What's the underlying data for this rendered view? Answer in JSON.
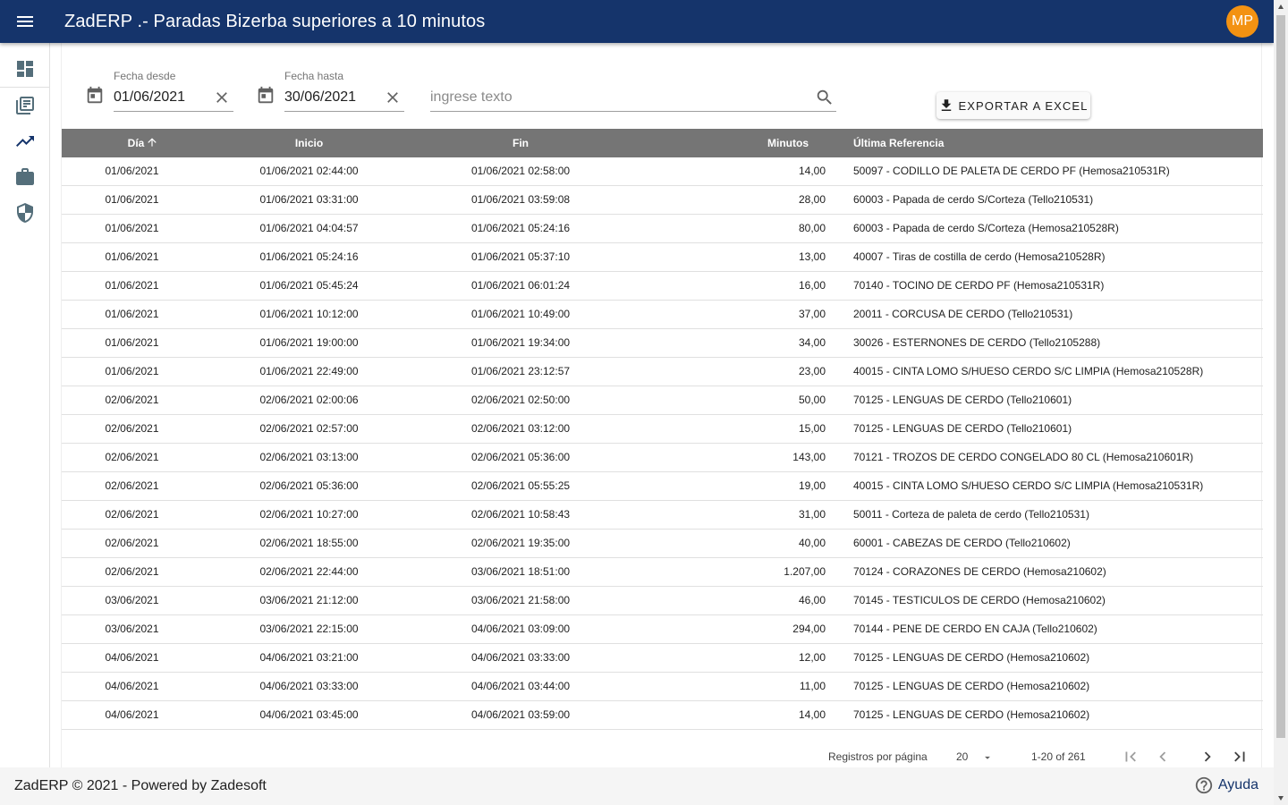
{
  "app": {
    "title": "ZadERP .- Paradas Bizerba superiores a 10 minutos",
    "user_initials": "MP",
    "accent_color": "#15346b",
    "avatar_color": "#f39212"
  },
  "sidebar": {
    "items": [
      {
        "icon": "dashboard-icon"
      },
      {
        "icon": "library-books-icon"
      },
      {
        "icon": "trending-up-icon"
      },
      {
        "icon": "briefcase-icon"
      },
      {
        "icon": "security-shield-icon"
      }
    ]
  },
  "filters": {
    "fecha_desde": {
      "label": "Fecha desde",
      "value": "01/06/2021"
    },
    "fecha_hasta": {
      "label": "Fecha hasta",
      "value": "30/06/2021"
    },
    "search": {
      "placeholder": "ingrese texto"
    },
    "export_label": "EXPORTAR A EXCEL"
  },
  "table": {
    "headers": {
      "dia": "Día",
      "inicio": "Inicio",
      "fin": "Fin",
      "minutos": "Minutos",
      "referencia": "Última Referencia"
    },
    "rows": [
      {
        "dia": "01/06/2021",
        "inicio": "01/06/2021 02:44:00",
        "fin": "01/06/2021 02:58:00",
        "minutos": "14,00",
        "referencia": "50097 - CODILLO DE PALETA DE CERDO PF (Hemosa210531R)"
      },
      {
        "dia": "01/06/2021",
        "inicio": "01/06/2021 03:31:00",
        "fin": "01/06/2021 03:59:08",
        "minutos": "28,00",
        "referencia": "60003 - Papada de cerdo S/Corteza (Tello210531)"
      },
      {
        "dia": "01/06/2021",
        "inicio": "01/06/2021 04:04:57",
        "fin": "01/06/2021 05:24:16",
        "minutos": "80,00",
        "referencia": "60003 - Papada de cerdo S/Corteza (Hemosa210528R)"
      },
      {
        "dia": "01/06/2021",
        "inicio": "01/06/2021 05:24:16",
        "fin": "01/06/2021 05:37:10",
        "minutos": "13,00",
        "referencia": "40007 - Tiras de costilla de cerdo (Hemosa210528R)"
      },
      {
        "dia": "01/06/2021",
        "inicio": "01/06/2021 05:45:24",
        "fin": "01/06/2021 06:01:24",
        "minutos": "16,00",
        "referencia": "70140 - TOCINO DE CERDO PF (Hemosa210531R)"
      },
      {
        "dia": "01/06/2021",
        "inicio": "01/06/2021 10:12:00",
        "fin": "01/06/2021 10:49:00",
        "minutos": "37,00",
        "referencia": "20011 - CORCUSA DE CERDO (Tello210531)"
      },
      {
        "dia": "01/06/2021",
        "inicio": "01/06/2021 19:00:00",
        "fin": "01/06/2021 19:34:00",
        "minutos": "34,00",
        "referencia": "30026 - ESTERNONES DE CERDO (Tello2105288)"
      },
      {
        "dia": "01/06/2021",
        "inicio": "01/06/2021 22:49:00",
        "fin": "01/06/2021 23:12:57",
        "minutos": "23,00",
        "referencia": "40015 - CINTA LOMO S/HUESO CERDO S/C LIMPIA (Hemosa210528R)"
      },
      {
        "dia": "02/06/2021",
        "inicio": "02/06/2021 02:00:06",
        "fin": "02/06/2021 02:50:00",
        "minutos": "50,00",
        "referencia": "70125 - LENGUAS DE CERDO (Tello210601)"
      },
      {
        "dia": "02/06/2021",
        "inicio": "02/06/2021 02:57:00",
        "fin": "02/06/2021 03:12:00",
        "minutos": "15,00",
        "referencia": "70125 - LENGUAS DE CERDO (Tello210601)"
      },
      {
        "dia": "02/06/2021",
        "inicio": "02/06/2021 03:13:00",
        "fin": "02/06/2021 05:36:00",
        "minutos": "143,00",
        "referencia": "70121 - TROZOS DE CERDO CONGELADO 80 CL (Hemosa210601R)"
      },
      {
        "dia": "02/06/2021",
        "inicio": "02/06/2021 05:36:00",
        "fin": "02/06/2021 05:55:25",
        "minutos": "19,00",
        "referencia": "40015 - CINTA LOMO S/HUESO CERDO S/C LIMPIA (Hemosa210531R)"
      },
      {
        "dia": "02/06/2021",
        "inicio": "02/06/2021 10:27:00",
        "fin": "02/06/2021 10:58:43",
        "minutos": "31,00",
        "referencia": "50011 - Corteza de paleta de cerdo (Tello210531)"
      },
      {
        "dia": "02/06/2021",
        "inicio": "02/06/2021 18:55:00",
        "fin": "02/06/2021 19:35:00",
        "minutos": "40,00",
        "referencia": "60001 - CABEZAS DE CERDO (Tello210602)"
      },
      {
        "dia": "02/06/2021",
        "inicio": "02/06/2021 22:44:00",
        "fin": "03/06/2021 18:51:00",
        "minutos": "1.207,00",
        "referencia": "70124 - CORAZONES DE CERDO (Hemosa210602)"
      },
      {
        "dia": "03/06/2021",
        "inicio": "03/06/2021 21:12:00",
        "fin": "03/06/2021 21:58:00",
        "minutos": "46,00",
        "referencia": "70145 - TESTICULOS DE CERDO (Hemosa210602)"
      },
      {
        "dia": "03/06/2021",
        "inicio": "03/06/2021 22:15:00",
        "fin": "04/06/2021 03:09:00",
        "minutos": "294,00",
        "referencia": "70144 - PENE DE CERDO EN CAJA (Tello210602)"
      },
      {
        "dia": "04/06/2021",
        "inicio": "04/06/2021 03:21:00",
        "fin": "04/06/2021 03:33:00",
        "minutos": "12,00",
        "referencia": "70125 - LENGUAS DE CERDO (Hemosa210602)"
      },
      {
        "dia": "04/06/2021",
        "inicio": "04/06/2021 03:33:00",
        "fin": "04/06/2021 03:44:00",
        "minutos": "11,00",
        "referencia": "70125 - LENGUAS DE CERDO (Hemosa210602)"
      },
      {
        "dia": "04/06/2021",
        "inicio": "04/06/2021 03:45:00",
        "fin": "04/06/2021 03:59:00",
        "minutos": "14,00",
        "referencia": "70125 - LENGUAS DE CERDO (Hemosa210602)"
      }
    ]
  },
  "paginator": {
    "label": "Registros por página",
    "page_size": "20",
    "range": "1-20 of 261"
  },
  "footer": {
    "text": "ZadERP © 2021 - Powered by Zadesoft",
    "help_label": "Ayuda"
  }
}
